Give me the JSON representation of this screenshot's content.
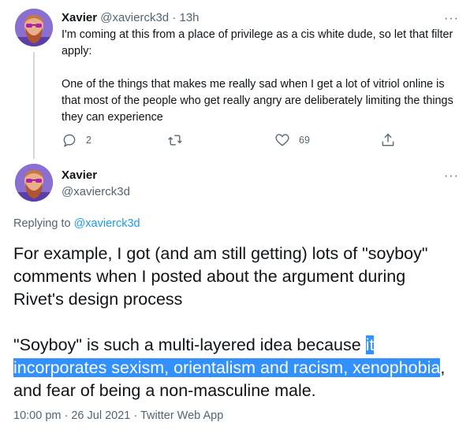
{
  "tweet1": {
    "name": "Xavier",
    "handle": "@xavierck3d",
    "separator": "·",
    "time": "13h",
    "more": "···",
    "paragraph1": "I'm coming at this from a place of privilege as a cis white dude, so let that filter apply:",
    "paragraph2": "One of the things that makes me really sad when I get a lot of vitriol online is that most of the people who get really angry are deliberately limiting the things they can experience",
    "actions": {
      "reply_icon": "reply-icon",
      "reply_count": "2",
      "retweet_icon": "retweet-icon",
      "retweet_count": "",
      "like_icon": "heart-icon",
      "like_count": "69",
      "share_icon": "share-icon"
    }
  },
  "tweet2": {
    "name": "Xavier",
    "handle": "@xavierck3d",
    "more": "···",
    "replying_prefix": "Replying to",
    "replying_to": "@xavierck3d",
    "paragraph1": "For example, I got (and am still getting) lots of \"soyboy\" comments when I posted about the argument during Rivet's design process",
    "paragraph2_before": "\"Soyboy\" is such a multi-layered idea because ",
    "paragraph2_highlighted": "it incorporates sexism, orientalism and racism, xenophobia",
    "paragraph2_after": ", and fear of being a non-masculine male.",
    "timestamp": "10:00 pm · 26 Jul 2021 · Twitter Web App"
  },
  "colors": {
    "text": "#0f1419",
    "muted": "#536471",
    "link": "#1d9bf0",
    "selection": "#3390ff",
    "thread_line": "#cfd9de"
  }
}
